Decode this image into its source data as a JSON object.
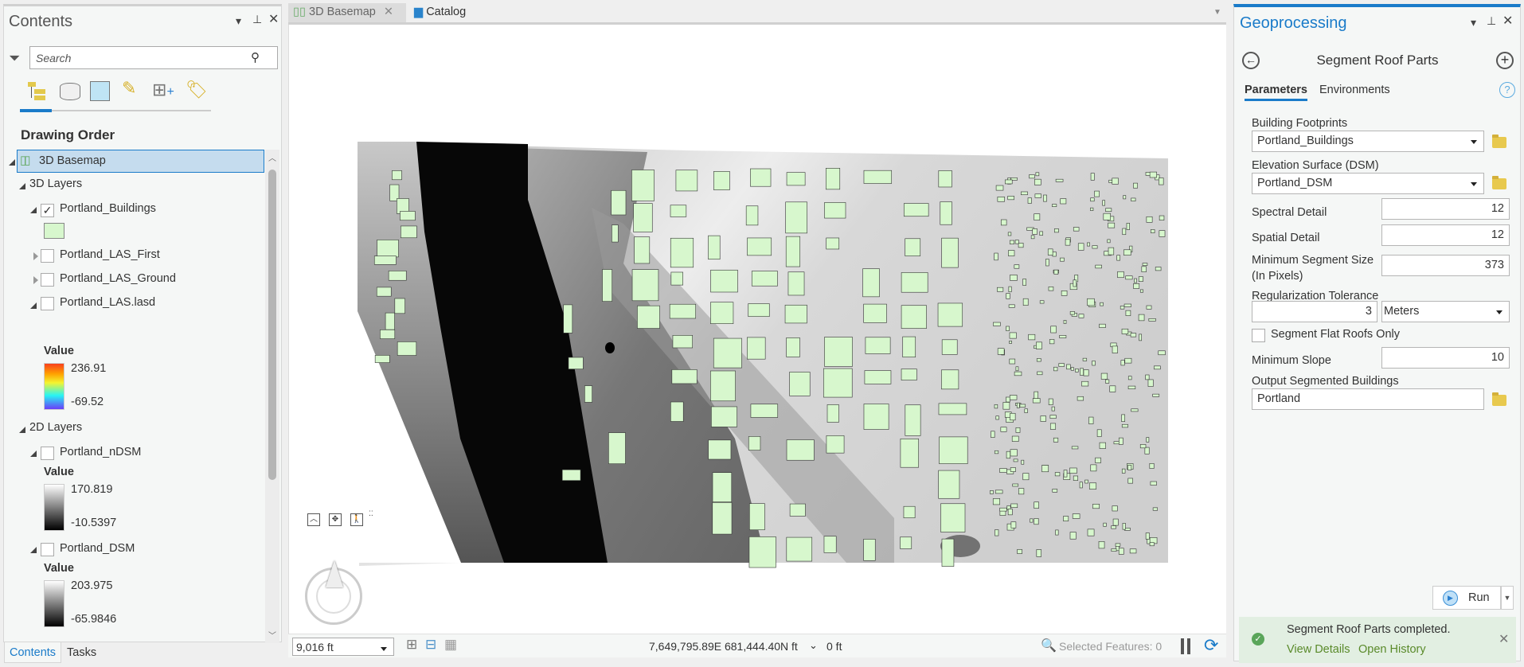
{
  "contents": {
    "title": "Contents",
    "search_placeholder": "Search",
    "section_title": "Drawing Order",
    "basemap": "3D Basemap",
    "group_3d": "3D Layers",
    "layers_3d": [
      {
        "name": "Portland_Buildings",
        "checked": true
      },
      {
        "name": "Portland_LAS_First",
        "checked": false
      },
      {
        "name": "Portland_LAS_Ground",
        "checked": false
      },
      {
        "name": "Portland_LAS.lasd",
        "checked": false
      }
    ],
    "building_swatch_color": "#d7f7cd",
    "las_legend": {
      "title": "Value",
      "max": "236.91",
      "min": "-69.52"
    },
    "group_2d": "2D Layers",
    "ndsm": {
      "name": "Portland_nDSM",
      "legend_title": "Value",
      "max": "170.819",
      "min": "-10.5397"
    },
    "dsm": {
      "name": "Portland_DSM",
      "legend_title": "Value",
      "max": "203.975",
      "min": "-65.9846"
    },
    "bottom_tabs": [
      "Contents",
      "Tasks"
    ]
  },
  "map": {
    "tabs": [
      {
        "label": "3D Basemap",
        "active": true
      },
      {
        "label": "Catalog",
        "active": false
      }
    ],
    "building_color": "#d7f7cd"
  },
  "status": {
    "scale": "9,016 ft",
    "coordinates": "7,649,795.89E 681,444.40N ft",
    "elevation": "0 ft",
    "selected_features": "Selected Features: 0"
  },
  "geoprocessing": {
    "title": "Geoprocessing",
    "tool_name": "Segment Roof Parts",
    "tabs": [
      "Parameters",
      "Environments"
    ],
    "params": {
      "building_footprints_label": "Building Footprints",
      "building_footprints_value": "Portland_Buildings",
      "elevation_label": "Elevation Surface (DSM)",
      "elevation_value": "Portland_DSM",
      "spectral_label": "Spectral Detail",
      "spectral_value": "12",
      "spatial_label": "Spatial Detail",
      "spatial_value": "12",
      "min_seg_label_1": "Minimum Segment Size",
      "min_seg_label_2": "(In Pixels)",
      "min_seg_value": "373",
      "reg_tol_label": "Regularization Tolerance",
      "reg_tol_value": "3",
      "reg_tol_unit": "Meters",
      "flat_roofs_label": "Segment Flat Roofs Only",
      "min_slope_label": "Minimum Slope",
      "min_slope_value": "10",
      "output_label": "Output Segmented Buildings",
      "output_value": "Portland"
    },
    "run_label": "Run",
    "notification": {
      "message": "Segment Roof Parts completed.",
      "view_details": "View Details",
      "open_history": "Open History"
    },
    "accent_color": "#1a7bc9"
  }
}
